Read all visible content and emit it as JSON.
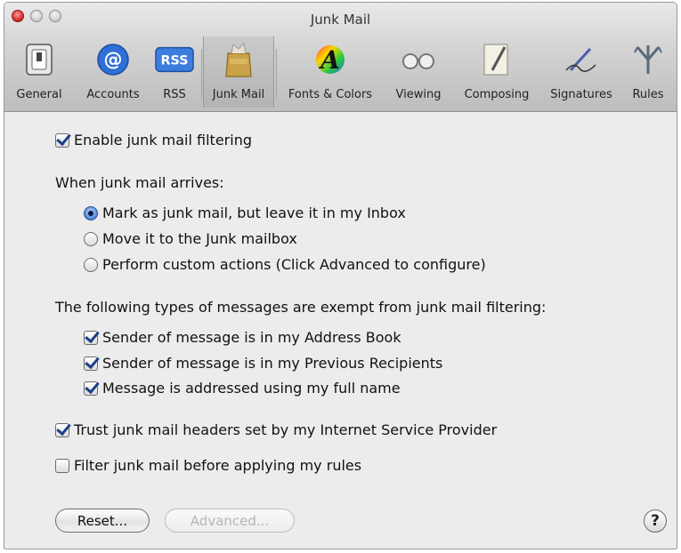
{
  "window": {
    "title": "Junk Mail"
  },
  "toolbar": {
    "items": [
      {
        "label": "General",
        "icon": "general-switch-icon"
      },
      {
        "label": "Accounts",
        "icon": "at-sign-icon"
      },
      {
        "label": "RSS",
        "icon": "rss-icon",
        "icon_text": "RSS"
      },
      {
        "label": "Junk Mail",
        "icon": "junk-mail-bag-icon",
        "selected": true
      },
      {
        "label": "Fonts & Colors",
        "icon": "fonts-colors-icon",
        "icon_text": "A"
      },
      {
        "label": "Viewing",
        "icon": "viewing-glasses-icon"
      },
      {
        "label": "Composing",
        "icon": "composing-pen-icon"
      },
      {
        "label": "Signatures",
        "icon": "signature-pen-icon"
      },
      {
        "label": "Rules",
        "icon": "rules-icon"
      }
    ]
  },
  "settings": {
    "enable_filtering": {
      "label": "Enable junk mail filtering",
      "checked": true
    },
    "arrival_heading": "When junk mail arrives:",
    "arrival_options": [
      {
        "label": "Mark as junk mail, but leave it in my Inbox",
        "selected": true
      },
      {
        "label": "Move it to the Junk mailbox",
        "selected": false
      },
      {
        "label": "Perform custom actions (Click Advanced to configure)",
        "selected": false
      }
    ],
    "exempt_heading": "The following types of messages are exempt from junk mail filtering:",
    "exempt_options": [
      {
        "label": "Sender of message is in my Address Book",
        "checked": true
      },
      {
        "label": "Sender of message is in my Previous Recipients",
        "checked": true
      },
      {
        "label": "Message is addressed using my full name",
        "checked": true
      }
    ],
    "trust_headers": {
      "label": "Trust junk mail headers set by my Internet Service Provider",
      "checked": true
    },
    "filter_before_rules": {
      "label": "Filter junk mail before applying my rules",
      "checked": false
    }
  },
  "buttons": {
    "reset": "Reset...",
    "advanced": "Advanced...",
    "help": "?"
  },
  "colors": {
    "accent": "#2a5fb8",
    "close": "#d92d2d"
  }
}
